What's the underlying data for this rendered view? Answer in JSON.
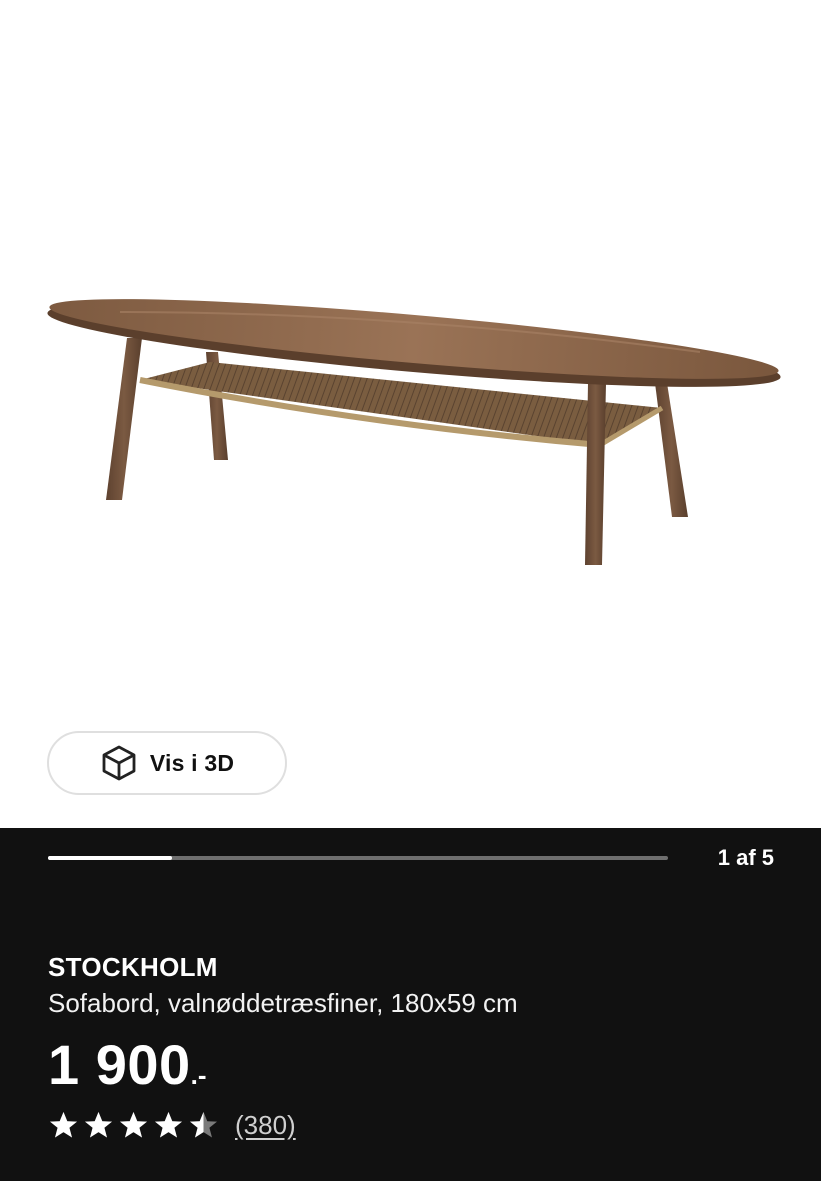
{
  "product": {
    "name": "STOCKHOLM",
    "description": "Sofabord, valnøddetræsfiner, 180x59 cm",
    "price": "1 900",
    "price_suffix": ".-",
    "rating": 4.5,
    "rating_max": 5,
    "review_count": "(380)"
  },
  "gallery": {
    "view_3d_label": "Vis i 3D",
    "counter": "1 af 5",
    "current": 1,
    "total": 5
  },
  "colors": {
    "panel_background": "#111111",
    "progress_track": "#6f6f6f",
    "progress_fill": "#ffffff",
    "wood": "#8a6446"
  }
}
